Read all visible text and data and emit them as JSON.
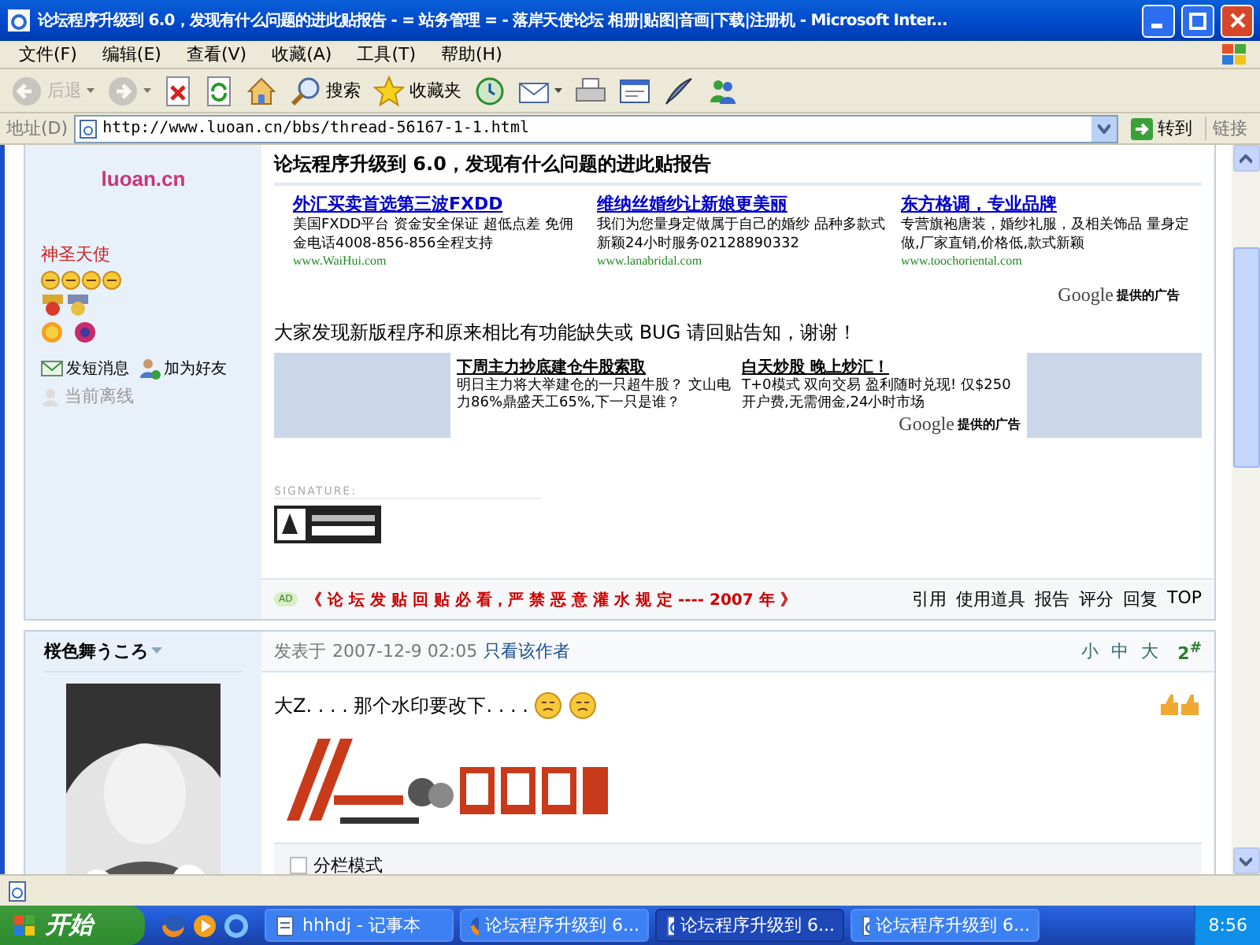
{
  "window": {
    "title": "论坛程序升级到 6.0，发现有什么问题的进此贴报告 - = 站务管理 = - 落岸天使论坛 相册|贴图|音画|下载|注册机 - Microsoft Inter..."
  },
  "menu": [
    {
      "label": "文件(F)"
    },
    {
      "label": "编辑(E)"
    },
    {
      "label": "查看(V)"
    },
    {
      "label": "收藏(A)"
    },
    {
      "label": "工具(T)"
    },
    {
      "label": "帮助(H)"
    }
  ],
  "toolbar": [
    {
      "kind": "back",
      "label": "后退",
      "disabled": true,
      "dropdown": true
    },
    {
      "kind": "forward",
      "disabled": true,
      "dropdown": true
    },
    {
      "kind": "stop",
      "disabled": false,
      "dropdown": false
    },
    {
      "kind": "refresh",
      "disabled": false,
      "dropdown": false
    },
    {
      "kind": "home",
      "disabled": false,
      "dropdown": false
    },
    {
      "kind": "search",
      "label": "搜索",
      "disabled": false,
      "dropdown": false
    },
    {
      "kind": "favorites",
      "label": "收藏夹",
      "disabled": false,
      "dropdown": false
    },
    {
      "kind": "history",
      "disabled": false,
      "dropdown": false
    },
    {
      "kind": "mail",
      "disabled": false,
      "dropdown": true
    },
    {
      "kind": "print",
      "disabled": false,
      "dropdown": false
    },
    {
      "kind": "edit",
      "disabled": false,
      "dropdown": false
    },
    {
      "kind": "discuss",
      "disabled": false,
      "dropdown": false
    },
    {
      "kind": "messenger",
      "disabled": false,
      "dropdown": false
    }
  ],
  "address": {
    "label": "地址(D)",
    "url": "http://www.luoan.cn/bbs/thread-56167-1-1.html",
    "go": "转到",
    "links": "链接"
  },
  "post1": {
    "author": {
      "logo_text": "luoan.cn",
      "rank": "神圣天使",
      "links": [
        {
          "kind": "message",
          "label": "发短消息"
        },
        {
          "kind": "friend",
          "label": "加为好友"
        }
      ],
      "status": "当前离线"
    },
    "title": "论坛程序升级到 6.0，发现有什么问题的进此贴报告",
    "ads": [
      {
        "title": "外汇买卖首选第三波FXDD",
        "text": "美国FXDD平台 资金安全保证 超低点差 免佣金电话4008-856-856全程支持",
        "url": "www.WaiHui.com"
      },
      {
        "title": "维纳丝婚纱让新娘更美丽",
        "text": "我们为您量身定做属于自己的婚纱 品种多款式新颖24小时服务02128890332",
        "url": "www.lanabridal.com"
      },
      {
        "title": "东方格调，专业品牌",
        "text": "专营旗袍唐装，婚纱礼服，及相关饰品 量身定做,厂家直销,价格低,款式新颖",
        "url": "www.toochoriental.com"
      }
    ],
    "ads_brand": "Google",
    "ads_by": "提供的广告",
    "message": "大家发现新版程序和原来相比有功能缺失或 BUG 请回贴告知，谢谢！",
    "ads2": [
      {
        "title": "下周主力抄底建仓牛股索取",
        "text": "明日主力将大举建仓的一只超牛股？ 文山电力86%鼎盛天工65%,下一只是谁？"
      },
      {
        "title": "白天炒股 晚上炒汇！",
        "text": "T+0模式 双向交易 盈利随时兑现! 仅$250开户费,无需佣金,24小时市场"
      }
    ],
    "ads2_brand": "Google",
    "ads2_by": "提供的广告",
    "signature_label": "SIGNATURE:",
    "notice_tag": "AD",
    "notice": "《 论 坛 发 贴 回 贴 必 看，严 禁 恶 意 灌 水 规 定 ---- 2007 年 》",
    "actions": [
      "引用",
      "使用道具",
      "报告",
      "评分",
      "回复",
      "TOP"
    ]
  },
  "post2": {
    "author": "桜色舞うころ",
    "posted_label": "发表于",
    "date": "2007-12-9 02:05",
    "only_author": "只看该作者",
    "font_sizes": [
      "小",
      "中",
      "大"
    ],
    "floor": "2$^{#}$",
    "body": "大Z. . . . 那个水印要改下. . . .",
    "split_view": {
      "label": "分栏模式",
      "checked": false
    }
  },
  "taskbar": {
    "start": "开始",
    "tasks": [
      {
        "kind": "notepad",
        "label": "hhhdj - 记事本",
        "selected": false
      },
      {
        "kind": "firefox",
        "label": "论坛程序升级到 6...",
        "selected": false
      },
      {
        "kind": "ie",
        "label": "论坛程序升级到 6...",
        "selected": true
      },
      {
        "kind": "ie",
        "label": "论坛程序升级到 6...",
        "selected": false
      }
    ],
    "clock": "8:56"
  }
}
